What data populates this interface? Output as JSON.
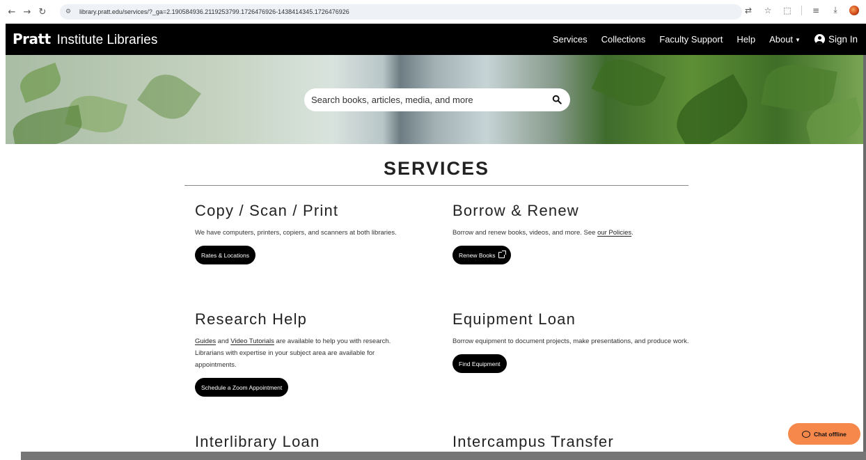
{
  "browser": {
    "url": "library.pratt.edu/services/?_ga=2.190584936.2119253799.1726476926-1438414345.1726476926",
    "icons": [
      "back-arrow-icon",
      "forward-arrow-icon",
      "reload-icon",
      "site-settings-icon",
      "translate-icon",
      "bookmark-star-icon",
      "extensions-icon",
      "reading-list-icon",
      "download-icon",
      "profile-icon"
    ]
  },
  "header": {
    "logo": "Pratt",
    "site_title": "Institute Libraries",
    "nav": {
      "services": "Services",
      "collections": "Collections",
      "faculty_support": "Faculty Support",
      "help": "Help",
      "about": "About",
      "sign_in": "Sign In"
    }
  },
  "search": {
    "placeholder": "Search books, articles, media, and more"
  },
  "page": {
    "title": "SERVICES"
  },
  "cards": {
    "copy": {
      "heading": "Copy / Scan / Print",
      "text": "We have computers, printers, copiers, and scanners at both libraries.",
      "button": "Rates & Locations"
    },
    "borrow": {
      "heading": "Borrow & Renew",
      "text_before": "Borrow and renew books, videos, and more. See ",
      "link": "our Policies",
      "text_after": ".",
      "button": "Renew Books"
    },
    "research": {
      "heading": "Research Help",
      "link1": "Guides",
      "and": " and ",
      "link2": "Video Tutorials",
      "text": " are available to help you with research. Librarians with expertise in your subject area are available for appointments.",
      "button": "Schedule a Zoom Appointment"
    },
    "equipment": {
      "heading": "Equipment Loan",
      "text": "Borrow equipment to document projects, make presentations, and produce work.",
      "button": "Find Equipment"
    },
    "interlibrary": {
      "heading": "Interlibrary Loan"
    },
    "intercampus": {
      "heading": "Intercampus Transfer"
    }
  },
  "chat": {
    "label": "Chat offline",
    "color": "#f7884b"
  },
  "colors": {
    "header_bg": "#000000",
    "button_bg": "#000000"
  }
}
